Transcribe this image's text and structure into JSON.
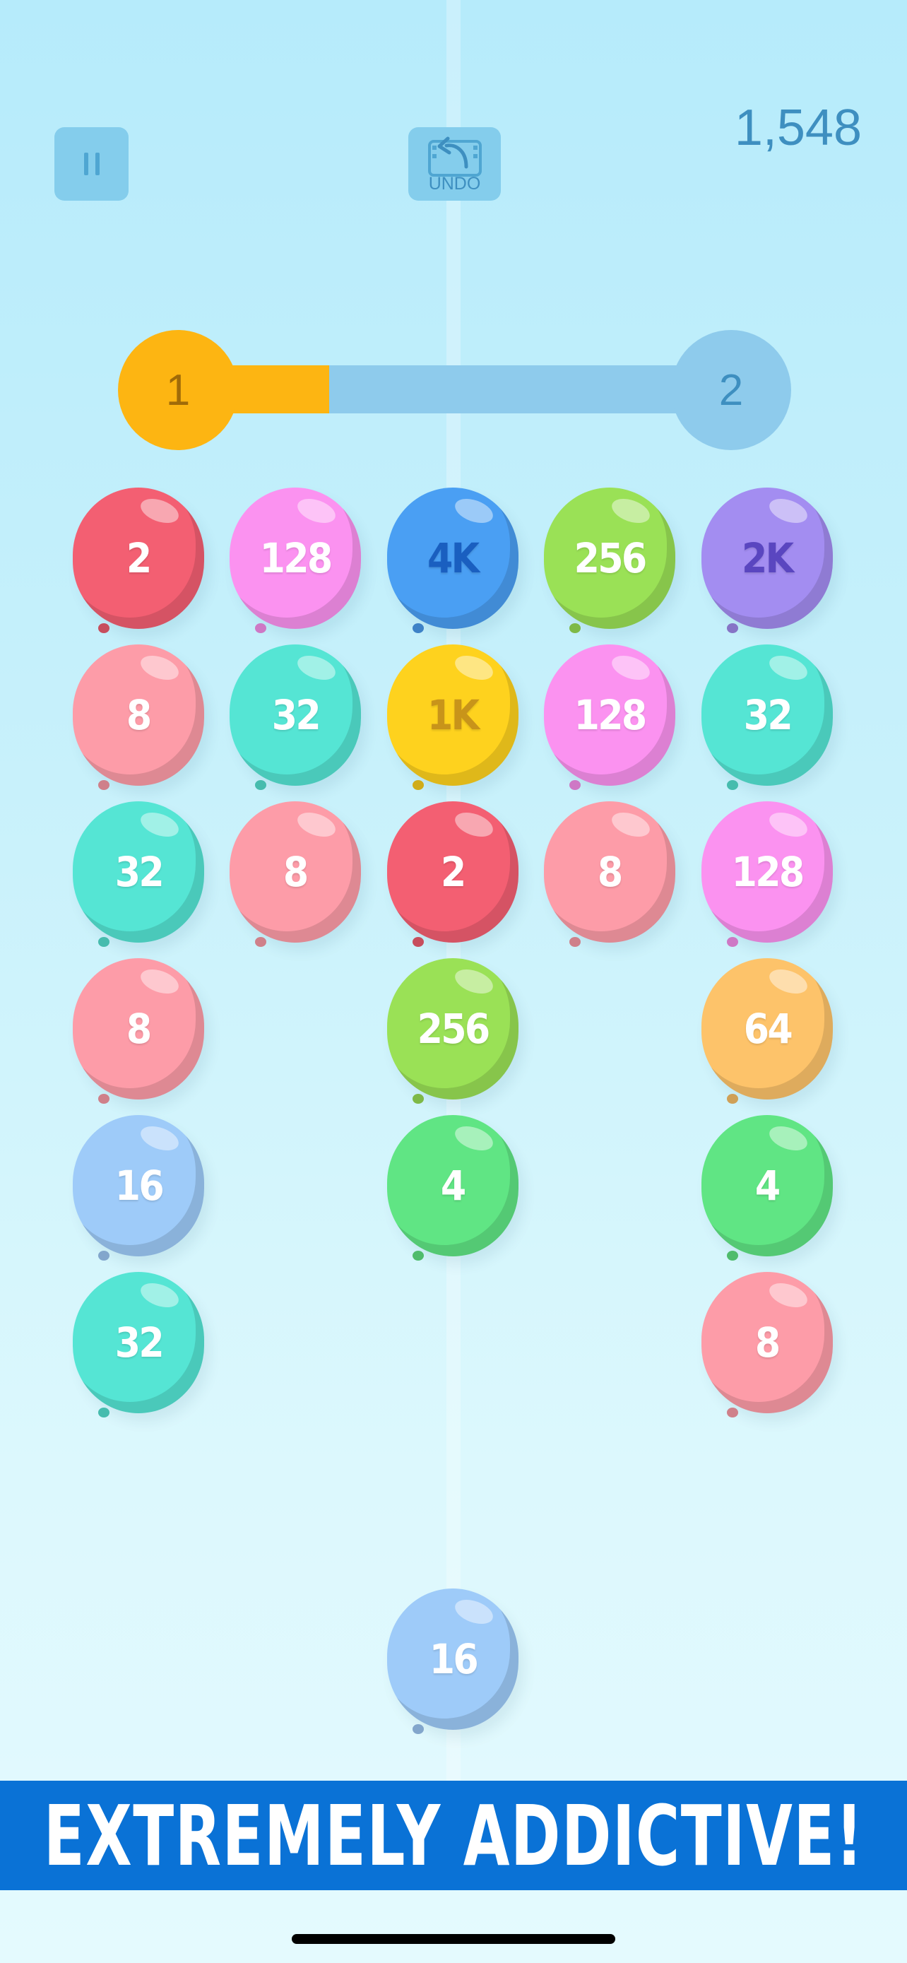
{
  "hud": {
    "score": "1,548",
    "pause_icon": "pause-icon",
    "undo_icon": "undo-icon",
    "undo_label": "UNDO"
  },
  "level": {
    "current": "1",
    "next": "2",
    "progress": 0.26,
    "colors": {
      "filled": "#fdb512",
      "empty": "#8ecbec"
    }
  },
  "board": {
    "rows": [
      [
        "2",
        "128",
        "4K",
        "256",
        "2K"
      ],
      [
        "8",
        "32",
        "1K",
        "128",
        "32"
      ],
      [
        "32",
        "8",
        "2",
        "8",
        "128"
      ],
      [
        "8",
        "",
        "256",
        "",
        "64"
      ],
      [
        "16",
        "",
        "4",
        "",
        "4"
      ],
      [
        "32",
        "",
        "",
        "",
        "8"
      ]
    ]
  },
  "next_balloon": "16",
  "balloon_colors": {
    "2": "#f35f72",
    "4": "#60e584",
    "8": "#fd9ca8",
    "16": "#9ecbf9",
    "32": "#55e5d4",
    "64": "#fdc36a",
    "128": "#fb92f0",
    "256": "#9ae156",
    "1K": "#fed21e",
    "2K": "#a38df1",
    "4K": "#4a9ff3"
  },
  "banner": {
    "text": "EXTREMELY ADDICTIVE!",
    "color": "#0a72d6"
  }
}
